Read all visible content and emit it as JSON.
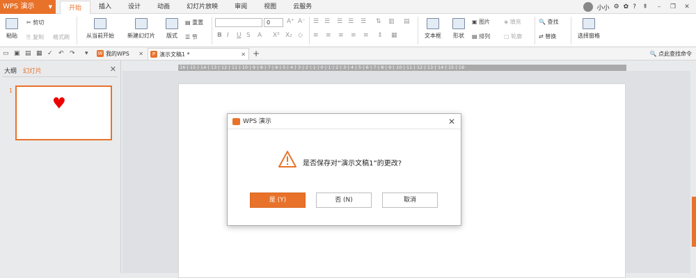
{
  "app": {
    "name": "WPS 演示",
    "brand_color": "#e8722a"
  },
  "menu_tabs": [
    "开始",
    "插入",
    "设计",
    "动画",
    "幻灯片放映",
    "审阅",
    "视图",
    "云服务"
  ],
  "user": {
    "name": "小小",
    "help": "?"
  },
  "ribbon": {
    "paste": "粘贴",
    "cut": "剪切",
    "copy": "复制",
    "format_painter": "格式刷",
    "from_current": "从当前开始",
    "new_slide": "新建幻灯片",
    "layout": "版式",
    "reset": "重置",
    "section": "节",
    "font_size": "0",
    "text_box": "文本框",
    "shape": "形状",
    "picture": "图片",
    "fill": "填充",
    "arrange": "排列",
    "outline": "轮廓",
    "find": "查找",
    "replace": "替换",
    "selection_pane": "选择窗格"
  },
  "doc_tabs": {
    "my_wps": "我的WPS",
    "current": "演示文稿1 *"
  },
  "search_cmd": "点此查找命令",
  "panel": {
    "outline_tab": "大纲",
    "slides_tab": "幻灯片",
    "slide_number": "1"
  },
  "ruler_text": "·16·|·15·|·14·|·13·|·12·|·11·|·10·|·9·|·8·|·7·|·6·|·5·|·4·|·3·|·2·|·1·|·0·|·1·|·2·|·3·|·4·|·5·|·6·|·7·|·8·|·9·|·10·|·11·|·12·|·13·|·14·|·15·|·16·",
  "dialog": {
    "title": "WPS 演示",
    "message": "是否保存对“演示文稿1”的更改?",
    "yes": "是 (Y)",
    "no": "否 (N)",
    "cancel": "取消"
  }
}
